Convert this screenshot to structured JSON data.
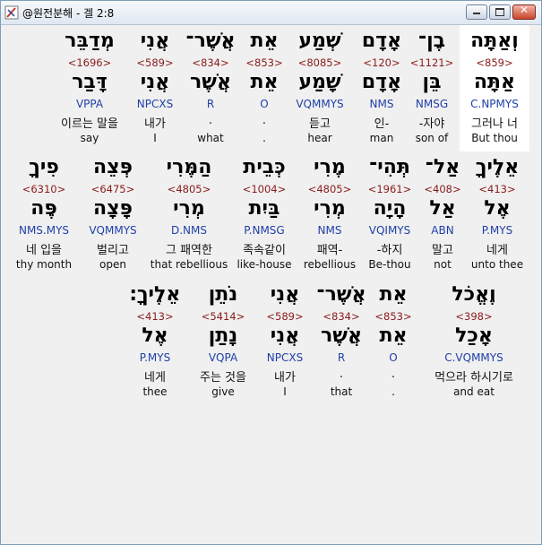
{
  "window": {
    "title": "@원전분해 - 겔 2:8",
    "icon": "app-icon"
  },
  "lines": [
    [
      {
        "hebrew": "וְאַתָּה",
        "strong": "<859>",
        "lemma": "אַתָּה",
        "morph": "C.NPMYS",
        "korean": "그러나 너",
        "english": "But thou"
      },
      {
        "hebrew": "בֶן־",
        "strong": "<1121>",
        "lemma": "בֵּן",
        "morph": "NMSG",
        "korean": "-자야",
        "english": "son of"
      },
      {
        "hebrew": "אָדָם",
        "strong": "<120>",
        "lemma": "אָדָם",
        "morph": "NMS",
        "korean": "인-",
        "english": "man"
      },
      {
        "hebrew": "שְׁמַע",
        "strong": "<8085>",
        "lemma": "שָׁמַע",
        "morph": "VQMMYS",
        "korean": "듣고",
        "english": "hear"
      },
      {
        "hebrew": "אֵת",
        "strong": "<853>",
        "lemma": "אֵת",
        "morph": "O",
        "korean": ".",
        "english": "."
      },
      {
        "hebrew": "אֲשֶׁר־",
        "strong": "<834>",
        "lemma": "אֲשֶׁר",
        "morph": "R",
        "korean": ".",
        "english": "what"
      },
      {
        "hebrew": "אֲנִי",
        "strong": "<589>",
        "lemma": "אֲנִי",
        "morph": "NPCXS",
        "korean": "내가",
        "english": "I"
      },
      {
        "hebrew": "מְדַבֵּר",
        "strong": "<1696>",
        "lemma": "דָּבַר",
        "morph": "VPPA",
        "korean": "이르는 말을",
        "english": "say"
      }
    ],
    [
      {
        "hebrew": "אֵלֶיךָ",
        "strong": "<413>",
        "lemma": "אֶל",
        "morph": "P.MYS",
        "korean": "네게",
        "english": "unto thee"
      },
      {
        "hebrew": "אַל־",
        "strong": "<408>",
        "lemma": "אַל",
        "morph": "ABN",
        "korean": "말고",
        "english": "not"
      },
      {
        "hebrew": "תְּהִי־",
        "strong": "<1961>",
        "lemma": "הָיָה",
        "morph": "VQIMYS",
        "korean": "-하지",
        "english": "Be-thou"
      },
      {
        "hebrew": "מֶרִי",
        "strong": "<4805>",
        "lemma": "מְרִי",
        "morph": "NMS",
        "korean": "패역-",
        "english": "rebellious"
      },
      {
        "hebrew": "כְּבֵית",
        "strong": "<1004>",
        "lemma": "בַּיִת",
        "morph": "P.NMSG",
        "korean": "족속같이",
        "english": "like-house"
      },
      {
        "hebrew": "הַמֶּרִי",
        "strong": "<4805>",
        "lemma": "מְרִי",
        "morph": "D.NMS",
        "korean": "그 패역한",
        "english": "that rebellious"
      },
      {
        "hebrew": "פְּצֵה",
        "strong": "<6475>",
        "lemma": "פָּצָה",
        "morph": "VQMMYS",
        "korean": "벌리고",
        "english": "open"
      },
      {
        "hebrew": "פִיךָ",
        "strong": "<6310>",
        "lemma": "פֶּה",
        "morph": "NMS.MYS",
        "korean": "네 입을",
        "english": "thy month"
      }
    ],
    [
      {
        "hebrew": "וֶאֱכֹל",
        "strong": "<398>",
        "lemma": "אָכַל",
        "morph": "C.VQMMYS",
        "korean": "먹으라 하시기로",
        "english": "and eat"
      },
      {
        "hebrew": "אֵת",
        "strong": "<853>",
        "lemma": "אֵת",
        "morph": "O",
        "korean": ".",
        "english": "."
      },
      {
        "hebrew": "אֲשֶׁר־",
        "strong": "<834>",
        "lemma": "אֲשֶׁר",
        "morph": "R",
        "korean": ".",
        "english": "that"
      },
      {
        "hebrew": "אֲנִי",
        "strong": "<589>",
        "lemma": "אֲנִי",
        "morph": "NPCXS",
        "korean": "내가",
        "english": "I"
      },
      {
        "hebrew": "נֹתֵן",
        "strong": "<5414>",
        "lemma": "נָתַן",
        "morph": "VQPA",
        "korean": "주는 것을",
        "english": "give"
      },
      {
        "hebrew": "אֵלֶיךָ׃",
        "strong": "<413>",
        "lemma": "אֶל",
        "morph": "P.MYS",
        "korean": "네게",
        "english": "thee"
      }
    ]
  ]
}
